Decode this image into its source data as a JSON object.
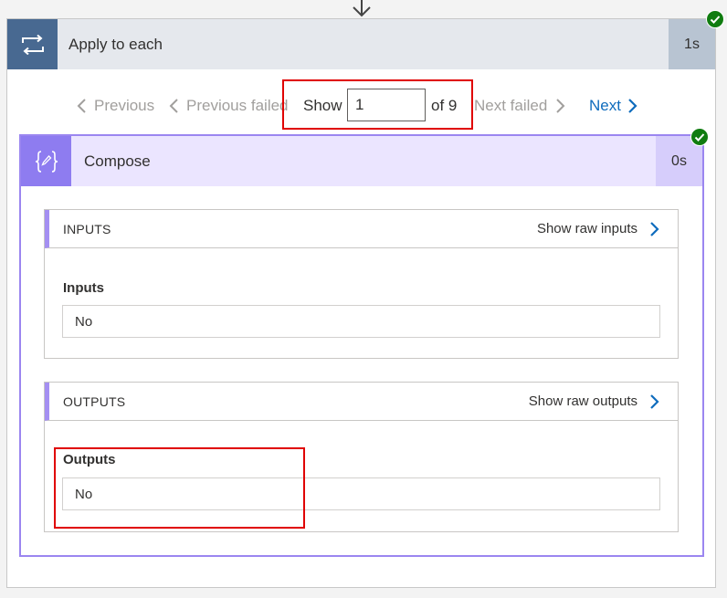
{
  "outer": {
    "title": "Apply to each",
    "duration": "1s",
    "icon": "loop-arrows-icon",
    "status": "succeeded"
  },
  "pager": {
    "previous_label": "Previous",
    "previous_failed_label": "Previous failed",
    "show_label": "Show",
    "current_value": "1",
    "of_label": "of 9",
    "next_failed_label": "Next failed",
    "next_label": "Next"
  },
  "compose": {
    "title": "Compose",
    "duration": "0s",
    "icon": "curly-braces-pencil-icon",
    "status": "succeeded",
    "inputs": {
      "header": "INPUTS",
      "show_raw_label": "Show raw inputs",
      "field_label": "Inputs",
      "field_value": "No"
    },
    "outputs": {
      "header": "OUTPUTS",
      "show_raw_label": "Show raw outputs",
      "field_label": "Outputs",
      "field_value": "No"
    }
  },
  "colors": {
    "success": "#107c10",
    "link": "#0f6cbd",
    "highlight": "#e00000",
    "outer_icon_bg": "#486991",
    "compose_accent": "#8e7cf0"
  }
}
